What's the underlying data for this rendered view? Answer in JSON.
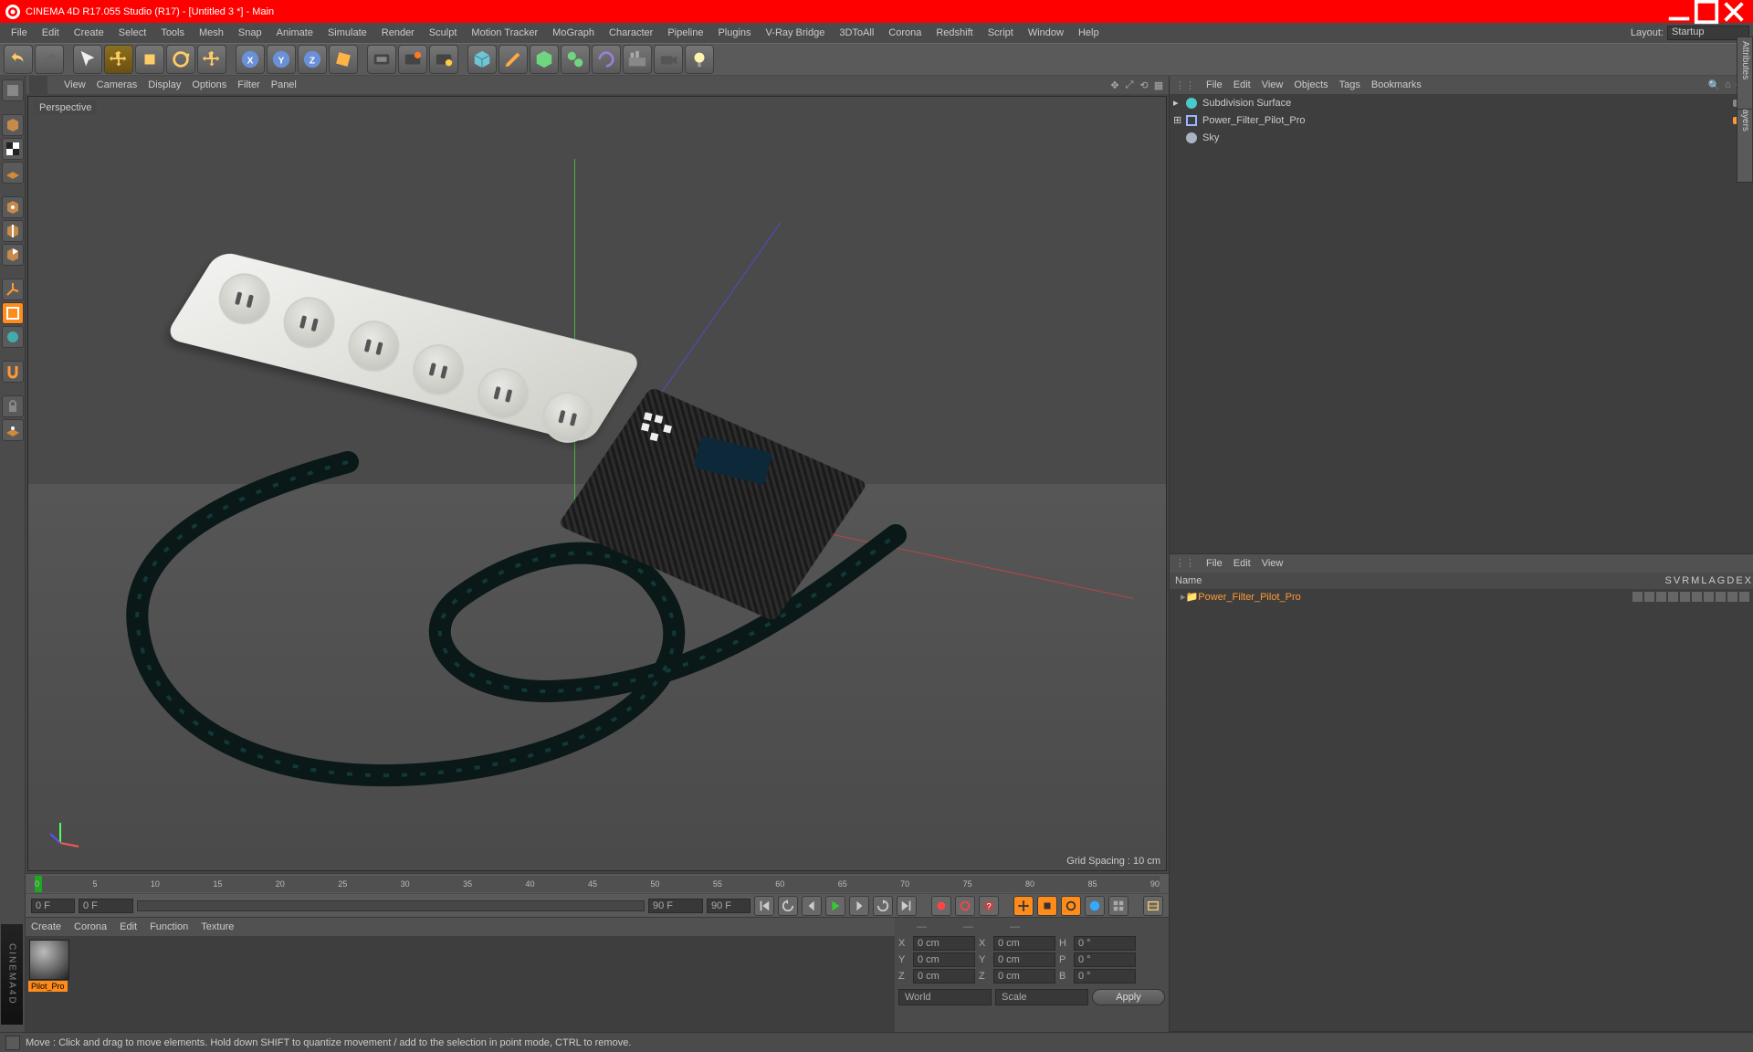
{
  "titlebar": {
    "title": "CINEMA 4D R17.055 Studio (R17) - [Untitled 3 *] - Main"
  },
  "menubar": {
    "items": [
      "File",
      "Edit",
      "Create",
      "Select",
      "Tools",
      "Mesh",
      "Snap",
      "Animate",
      "Simulate",
      "Render",
      "Sculpt",
      "Motion Tracker",
      "MoGraph",
      "Character",
      "Pipeline",
      "Plugins",
      "V-Ray Bridge",
      "3DToAll",
      "Corona",
      "Redshift",
      "Script",
      "Window",
      "Help"
    ],
    "layout_label": "Layout:",
    "layout_value": "Startup"
  },
  "viewport": {
    "menu": [
      "View",
      "Cameras",
      "Display",
      "Options",
      "Filter",
      "Panel"
    ],
    "label": "Perspective",
    "grid_info": "Grid Spacing : 10 cm"
  },
  "objects_panel": {
    "menu": [
      "File",
      "Edit",
      "View",
      "Objects",
      "Tags",
      "Bookmarks"
    ],
    "items": [
      {
        "name": "Subdivision Surface",
        "level": 0,
        "color": "#4ac9c9",
        "tag1": "#888",
        "tag2": "#5fbf5f"
      },
      {
        "name": "Power_Filter_Pilot_Pro",
        "level": 0,
        "color": "#9bb6ff",
        "tag1": "#ff9933",
        "tag2": "#5fbf5f"
      },
      {
        "name": "Sky",
        "level": 0,
        "color": "#aab",
        "tag1": "#888",
        "tag2": ""
      }
    ]
  },
  "takes_panel": {
    "menu": [
      "File",
      "Edit",
      "View"
    ],
    "header": {
      "name": "Name",
      "cols": [
        "S",
        "V",
        "R",
        "M",
        "L",
        "A",
        "G",
        "D",
        "E",
        "X"
      ]
    },
    "row": {
      "name": "Power_Filter_Pilot_Pro"
    }
  },
  "timeline": {
    "ticks": [
      "0",
      "5",
      "10",
      "15",
      "20",
      "25",
      "30",
      "35",
      "40",
      "45",
      "50",
      "55",
      "60",
      "65",
      "70",
      "75",
      "80",
      "85",
      "90"
    ],
    "start": "0 F",
    "end": "90 F",
    "range_start": "0 F",
    "range_end": "90 F"
  },
  "material_panel": {
    "menu": [
      "Create",
      "Corona",
      "Edit",
      "Function",
      "Texture"
    ],
    "thumb_label": "Pilot_Pro"
  },
  "coords": {
    "x": {
      "p": "0 cm",
      "s": "0 cm",
      "r": "0 °",
      "rl": "H"
    },
    "y": {
      "p": "0 cm",
      "s": "0 cm",
      "r": "0 °",
      "rl": "P"
    },
    "z": {
      "p": "0 cm",
      "s": "0 cm",
      "r": "0 °",
      "rl": "B"
    },
    "mode1": "World",
    "mode2": "Scale",
    "apply": "Apply"
  },
  "statusbar": {
    "text": "Move : Click and drag to move elements. Hold down SHIFT to quantize movement / add to the selection in point mode, CTRL to remove."
  },
  "side_tabs": {
    "t1": "Structure / Layers",
    "t2": "Attributes"
  },
  "logo": "CINEMA4D"
}
